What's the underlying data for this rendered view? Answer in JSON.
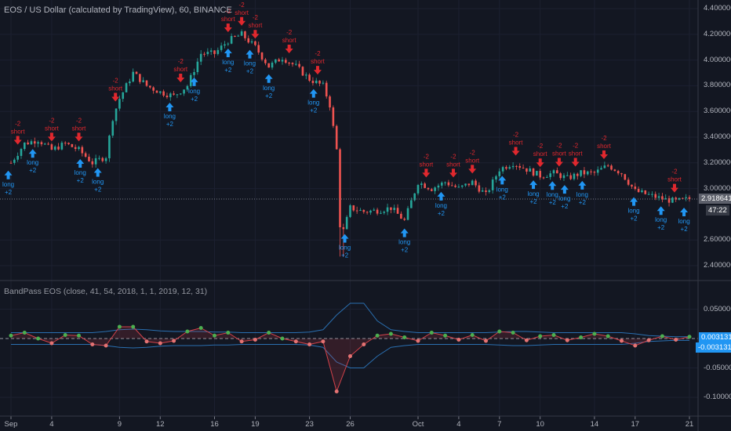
{
  "header": {
    "title": "EOS / US Dollar (calculated by TradingView), 60, BINANCE"
  },
  "indicator": {
    "title": "BandPass EOS (close, 41, 54, 2018, 1, 1, 2019, 12, 31)"
  },
  "price_axis": {
    "ticks": [
      "4.400000",
      "4.200000",
      "4.000000",
      "3.800000",
      "3.600000",
      "3.400000",
      "3.200000",
      "3.000000",
      "2.600000",
      "2.400000"
    ],
    "last_price": "2.918641",
    "countdown": "47:22"
  },
  "indicator_axis": {
    "ticks": [
      "0.050000",
      "-0.050000",
      "-0.100000"
    ],
    "upper_value": "0.003131",
    "lower_value": "-0.003131"
  },
  "time_axis": {
    "ticks": [
      "Sep",
      "4",
      "9",
      "12",
      "16",
      "19",
      "23",
      "26",
      "Oct",
      "4",
      "7",
      "10",
      "14",
      "17",
      "21"
    ]
  },
  "signal_labels": {
    "short_top": "-2",
    "short": "short",
    "long": "long",
    "long_bottom": "+2"
  },
  "colors": {
    "background": "#131722",
    "up": "#26a69a",
    "down": "#ef5350",
    "short": "#e0282e",
    "long": "#2196f3",
    "band": "#2a6fb0",
    "osc": "#d3424a"
  },
  "chart_data": [
    {
      "type": "candlestick",
      "title": "EOS / US Dollar (calculated by TradingView), 60, BINANCE",
      "x_unit": "day (0 = Sep 1, 30 = Oct 1)",
      "ylim": [
        2.3,
        4.45
      ],
      "close_path": [
        [
          0,
          3.2
        ],
        [
          1,
          3.35
        ],
        [
          2,
          3.38
        ],
        [
          3,
          3.3
        ],
        [
          4,
          3.35
        ],
        [
          5,
          3.3
        ],
        [
          6,
          3.2
        ],
        [
          7,
          3.25
        ],
        [
          7.5,
          3.55
        ],
        [
          8,
          3.7
        ],
        [
          9,
          3.9
        ],
        [
          10,
          3.8
        ],
        [
          11,
          3.75
        ],
        [
          12,
          3.72
        ],
        [
          13,
          3.8
        ],
        [
          14,
          4.05
        ],
        [
          15,
          4.05
        ],
        [
          16,
          4.15
        ],
        [
          17,
          4.2
        ],
        [
          18,
          4.1
        ],
        [
          19,
          3.95
        ],
        [
          20,
          4.02
        ],
        [
          21,
          3.95
        ],
        [
          22,
          3.85
        ],
        [
          23,
          3.8
        ],
        [
          23.5,
          3.65
        ],
        [
          24,
          3.3
        ],
        [
          24.3,
          2.6
        ],
        [
          25,
          2.85
        ],
        [
          26,
          2.82
        ],
        [
          27,
          2.83
        ],
        [
          28,
          2.85
        ],
        [
          29,
          2.75
        ],
        [
          30,
          3.05
        ],
        [
          31,
          3.0
        ],
        [
          32,
          3.05
        ],
        [
          33,
          3.0
        ],
        [
          34,
          3.05
        ],
        [
          35,
          2.95
        ],
        [
          36,
          3.15
        ],
        [
          37,
          3.2
        ],
        [
          38,
          3.15
        ],
        [
          39,
          3.1
        ],
        [
          40,
          3.12
        ],
        [
          41,
          3.08
        ],
        [
          42,
          3.12
        ],
        [
          43,
          3.12
        ],
        [
          44,
          3.18
        ],
        [
          45,
          3.12
        ],
        [
          46,
          2.98
        ],
        [
          47,
          2.95
        ],
        [
          48,
          2.92
        ],
        [
          49,
          2.9
        ],
        [
          50,
          2.92
        ]
      ],
      "last_price": 2.918641,
      "signals": {
        "short": [
          0.5,
          3,
          5,
          7.7,
          12.5,
          16,
          17,
          18,
          20.5,
          22.6,
          30.6,
          32.6,
          34,
          37.2,
          39,
          40.4,
          41.6,
          43.7,
          48.9
        ],
        "long": [
          -0.2,
          1.6,
          5.1,
          6.4,
          11.7,
          13.5,
          16,
          17.6,
          19,
          22.3,
          24.6,
          29,
          31.7,
          36.2,
          38.5,
          39.9,
          40.8,
          42.1,
          45.9,
          47.9,
          49.6
        ]
      }
    },
    {
      "type": "line",
      "title": "BandPass EOS (close, 41, 54, 2018, 1, 1, 2019, 12, 31)",
      "ylim": [
        -0.115,
        0.075
      ],
      "zero_line": true,
      "oscillator": [
        0.005,
        0.01,
        0.0,
        -0.008,
        0.006,
        0.005,
        -0.01,
        -0.012,
        0.02,
        0.02,
        -0.005,
        -0.008,
        -0.004,
        0.012,
        0.018,
        0.005,
        0.01,
        -0.005,
        -0.002,
        0.01,
        0.0,
        -0.005,
        -0.01,
        -0.005,
        -0.09,
        -0.03,
        -0.01,
        0.005,
        0.008,
        0.002,
        -0.004,
        0.01,
        0.005,
        -0.002,
        0.006,
        -0.004,
        0.012,
        0.01,
        -0.003,
        0.004,
        0.006,
        -0.003,
        0.002,
        0.008,
        0.004,
        -0.004,
        -0.012,
        -0.003,
        0.004,
        -0.002,
        0.003
      ],
      "upper_band": [
        0.01,
        0.01,
        0.01,
        0.01,
        0.01,
        0.01,
        0.01,
        0.012,
        0.015,
        0.016,
        0.015,
        0.013,
        0.012,
        0.012,
        0.012,
        0.011,
        0.011,
        0.01,
        0.01,
        0.01,
        0.01,
        0.01,
        0.011,
        0.015,
        0.04,
        0.06,
        0.06,
        0.03,
        0.015,
        0.012,
        0.01,
        0.01,
        0.01,
        0.01,
        0.01,
        0.01,
        0.011,
        0.012,
        0.012,
        0.011,
        0.01,
        0.01,
        0.01,
        0.01,
        0.01,
        0.01,
        0.008,
        0.005,
        0.004,
        0.003,
        0.003131
      ],
      "lower_band": [
        -0.01,
        -0.01,
        -0.01,
        -0.01,
        -0.01,
        -0.01,
        -0.01,
        -0.012,
        -0.015,
        -0.016,
        -0.015,
        -0.013,
        -0.012,
        -0.012,
        -0.012,
        -0.011,
        -0.011,
        -0.01,
        -0.01,
        -0.01,
        -0.01,
        -0.01,
        -0.011,
        -0.015,
        -0.04,
        -0.05,
        -0.05,
        -0.03,
        -0.015,
        -0.012,
        -0.01,
        -0.01,
        -0.01,
        -0.01,
        -0.01,
        -0.01,
        -0.011,
        -0.012,
        -0.012,
        -0.011,
        -0.01,
        -0.01,
        -0.01,
        -0.01,
        -0.01,
        -0.01,
        -0.008,
        -0.005,
        -0.004,
        -0.003,
        -0.003131
      ]
    }
  ]
}
